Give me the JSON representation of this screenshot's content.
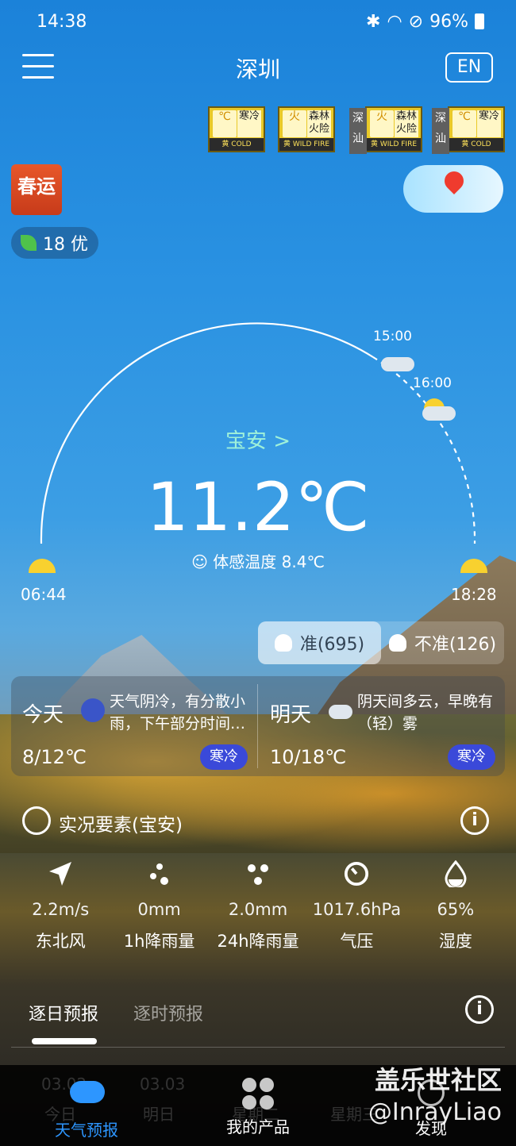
{
  "status_bar": {
    "time": "14:38",
    "battery": "96%"
  },
  "header": {
    "city": "深圳",
    "lang_button": "EN"
  },
  "warnings": [
    {
      "region": "",
      "glyph": "℃",
      "kind": "寒冷",
      "level": "黄",
      "code": "COLD"
    },
    {
      "region": "",
      "glyph": "火",
      "kind": "森林火险",
      "level": "黄",
      "code": "WILD FIRE"
    },
    {
      "region": "深汕",
      "glyph": "火",
      "kind": "森林火险",
      "level": "黄",
      "code": "WILD FIRE"
    },
    {
      "region": "深汕",
      "glyph": "℃",
      "kind": "寒冷",
      "level": "黄",
      "code": "COLD"
    }
  ],
  "badges": {
    "spring": "春运",
    "aqi": "18 优"
  },
  "sun_arc": {
    "sunrise": "06:44",
    "sunset": "18:28",
    "t1": "15:00",
    "t2": "16:00"
  },
  "current": {
    "location": "宝安 >",
    "temperature": "11.2℃",
    "feels_like": "体感温度 8.4℃"
  },
  "accuracy": {
    "accurate": "准(695)",
    "inaccurate": "不准(126)"
  },
  "days": [
    {
      "name": "今天",
      "desc": "天气阴冷，有分散小雨，下午部分时间…",
      "temp": "8/12℃",
      "badge": "寒冷"
    },
    {
      "name": "明天",
      "desc": "阴天间多云，早晚有（轻）雾",
      "temp": "10/18℃",
      "badge": "寒冷"
    }
  ],
  "observation": {
    "title": "实况要素(宝安)",
    "items": [
      {
        "icon": "navigation-arrow-icon",
        "value": "2.2m/s",
        "label": "东北风"
      },
      {
        "icon": "rain-drops-icon",
        "value": "0mm",
        "label": "1h降雨量"
      },
      {
        "icon": "rain-drops-icon",
        "value": "2.0mm",
        "label": "24h降雨量"
      },
      {
        "icon": "pressure-gauge-icon",
        "value": "1017.6hPa",
        "label": "气压"
      },
      {
        "icon": "humidity-drop-icon",
        "value": "65%",
        "label": "湿度"
      }
    ]
  },
  "tabs": {
    "daily": "逐日预报",
    "hourly": "逐时预报"
  },
  "ghost_row": {
    "d1": "03.02",
    "d2": "03.03",
    "l1": "今日",
    "l2": "明日",
    "l3": "星期二",
    "l4": "星期三"
  },
  "bottom_nav": {
    "weather": "天气预报",
    "products": "我的产品",
    "discover": "发现"
  },
  "watermark": {
    "line1": "盖乐世社区",
    "line2": "@InrayLiao"
  },
  "colors": {
    "accent_blue": "#2d96ff",
    "cold_badge": "#3a49d9",
    "location_link": "#9ff1d9"
  }
}
